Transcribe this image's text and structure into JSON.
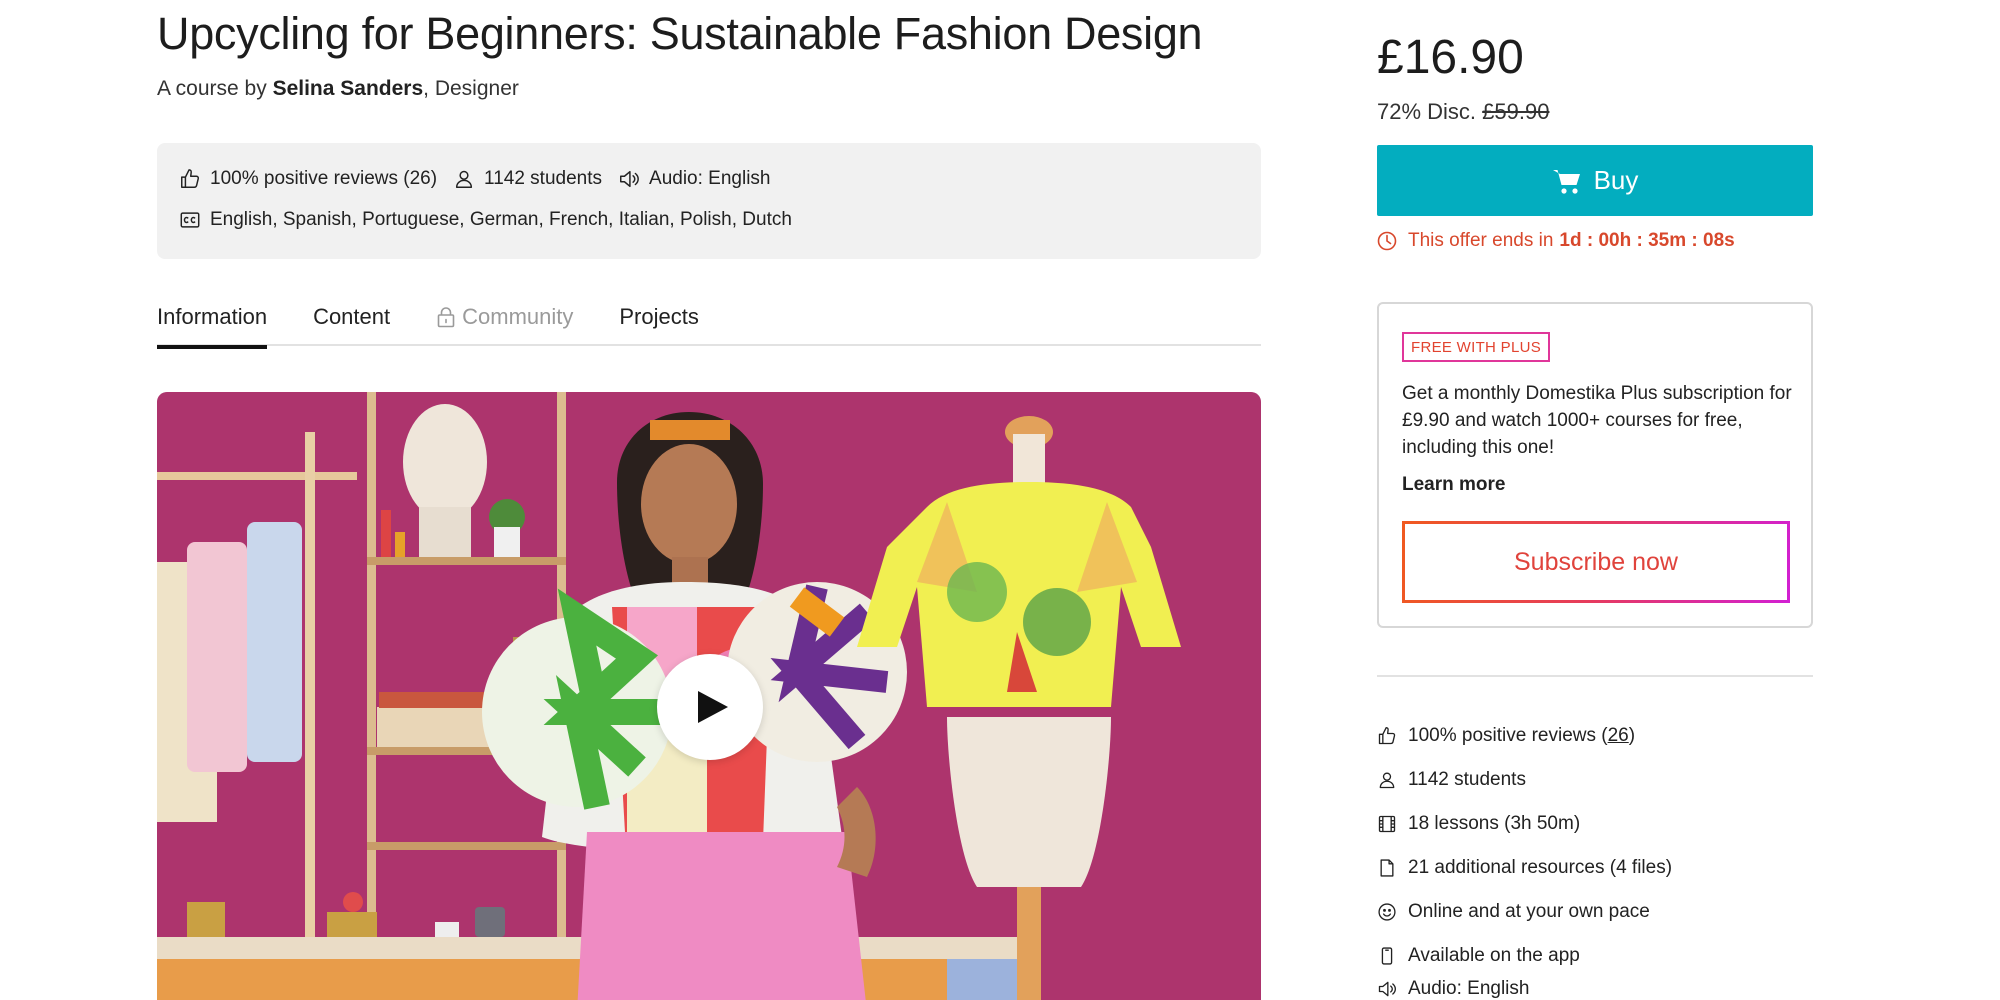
{
  "course": {
    "title": "Upcycling for Beginners: Sustainable Fashion Design",
    "byline_prefix": "A course by",
    "author": "Selina Sanders",
    "author_role": ", Designer"
  },
  "infobox": {
    "reviews": "100% positive reviews (26)",
    "students": "1142 students",
    "audio": "Audio: English",
    "subtitles": "English, Spanish, Portuguese, German, French, Italian, Polish, Dutch"
  },
  "tabs": [
    {
      "label": "Information",
      "active": true
    },
    {
      "label": "Content"
    },
    {
      "label": "Community",
      "locked": true
    },
    {
      "label": "Projects"
    }
  ],
  "purchase": {
    "price": "£16.90",
    "discount_label": "72% Disc.",
    "original_price": "£59.90",
    "buy_label": "Buy",
    "offer_text": "This offer ends in",
    "offer_countdown": "1d : 00h : 35m : 08s"
  },
  "plus": {
    "badge": "FREE WITH PLUS",
    "description": "Get a monthly Domestika Plus subscription for £9.90 and watch 1000+ courses for free, including this one!",
    "learn_more": "Learn more",
    "subscribe_label": "Subscribe now"
  },
  "features": {
    "reviews_prefix": "100% positive reviews (",
    "reviews_count": "26",
    "reviews_suffix": ")",
    "students": "1142 students",
    "lessons": "18 lessons (3h 50m)",
    "resources": "21 additional resources (4 files)",
    "pace": "Online and at your own pace",
    "app": "Available on the app",
    "audio": "Audio: English"
  },
  "colors": {
    "buy": "#03adbf",
    "offer": "#d8482c",
    "plus_badge_border": "#e0369a",
    "subscribe_gradient": [
      "#f05a1f",
      "#d21fd3"
    ]
  },
  "icons": {
    "reviews": "thumbs-up-icon",
    "students": "user-icon",
    "audio": "speaker-icon",
    "subtitles": "closed-captions-icon",
    "lock": "lock-icon",
    "play": "play-icon",
    "cart": "cart-icon",
    "offer": "clock-icon",
    "lessons": "film-icon",
    "resources": "file-icon",
    "pace": "smiley-icon",
    "app": "phone-icon"
  }
}
